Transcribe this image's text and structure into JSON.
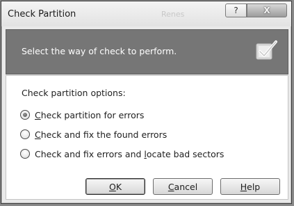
{
  "window": {
    "title": "Check Partition",
    "background_title": "Renes",
    "help_control": "?",
    "close_control": "X"
  },
  "banner": {
    "text": "Select the way of check to perform.",
    "icon": "checkmark-document-icon"
  },
  "options": {
    "label": "Check partition options:",
    "items": [
      {
        "accel": "C",
        "rest": "heck partition for errors",
        "checked": true
      },
      {
        "accel": "C",
        "rest": "heck and fix the found errors",
        "checked": false
      },
      {
        "prefix": "Check and fix errors and ",
        "accel": "l",
        "rest": "ocate bad sectors",
        "checked": false
      }
    ]
  },
  "buttons": {
    "ok": {
      "accel": "O",
      "rest": "K"
    },
    "cancel": {
      "accel": "C",
      "rest": "ancel"
    },
    "help": {
      "accel": "H",
      "rest": "elp"
    }
  },
  "colors": {
    "banner": "#767676",
    "panel": "#ffffff",
    "window": "#e9e9e9"
  }
}
